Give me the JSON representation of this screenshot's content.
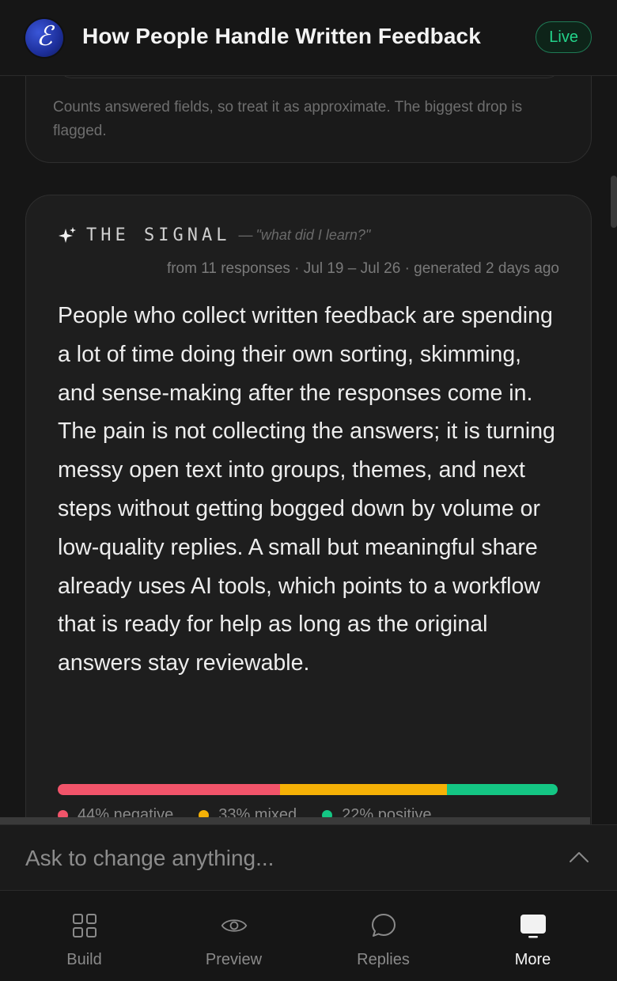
{
  "header": {
    "logo_glyph": "ℰ",
    "title": "How People Handle Written Feedback",
    "status_badge": "Live"
  },
  "previous_card": {
    "note": "Counts answered fields, so treat it as approximate. The biggest drop is flagged."
  },
  "signal": {
    "label": "THE SIGNAL",
    "dash": "—",
    "question": "\"what did I learn?\"",
    "meta": "from 11 responses · Jul 19 – Jul 26 · generated 2 days ago",
    "summary": "People who collect written feedback are spending a lot of time doing their own sorting, skimming, and sense-making after the responses come in. The pain is not collecting the answers; it is turning messy open text into groups, themes, and next steps without getting bogged down by volume or low-quality replies. A small but meaningful share already uses AI tools, which points to a workflow that is ready for help as long as the original answers stay reviewable.",
    "sentiment": [
      {
        "label": "44% negative",
        "value": 44,
        "color": "#f2546a"
      },
      {
        "label": "33% mixed",
        "value": 33,
        "color": "#f5b106"
      },
      {
        "label": "22% positive",
        "value": 22,
        "color": "#14c684"
      }
    ]
  },
  "prompt": {
    "placeholder": "Ask to change anything..."
  },
  "nav": {
    "items": [
      {
        "label": "Build",
        "icon": "grid-icon",
        "active": false
      },
      {
        "label": "Preview",
        "icon": "eye-icon",
        "active": false
      },
      {
        "label": "Replies",
        "icon": "chat-bubble-icon",
        "active": false
      },
      {
        "label": "More",
        "icon": "monitor-icon",
        "active": true
      }
    ]
  },
  "colors": {
    "accent_live": "#23d38a",
    "negative": "#f2546a",
    "mixed": "#f5b106",
    "positive": "#14c684"
  }
}
